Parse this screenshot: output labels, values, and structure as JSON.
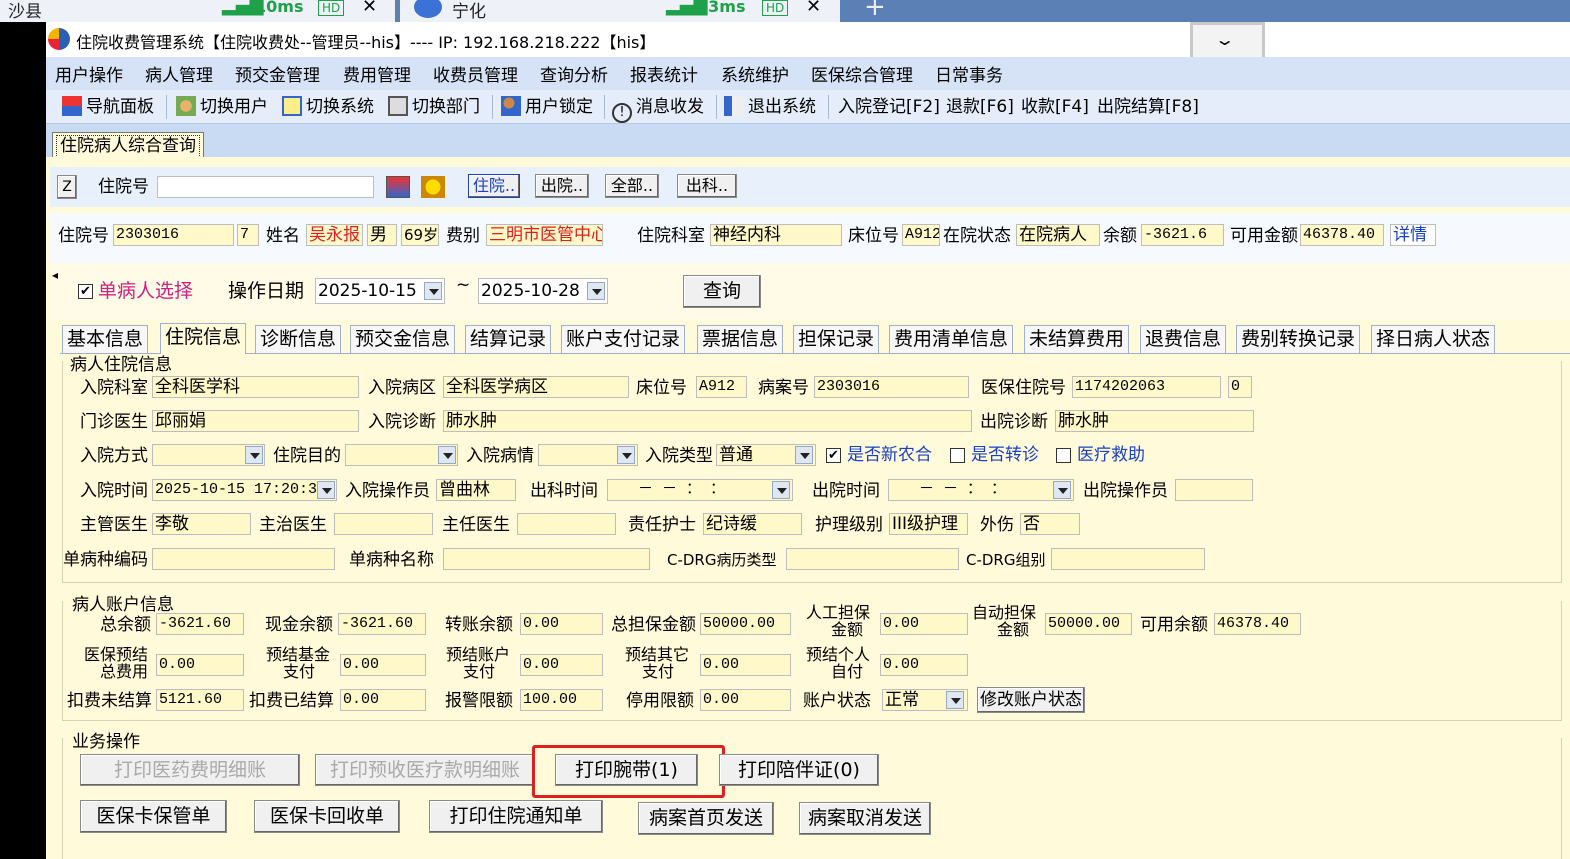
{
  "browser": {
    "tab1": {
      "title": "沙县",
      "latency": "10ms",
      "hd": "HD"
    },
    "tab2": {
      "title": "宁化",
      "latency": "13ms",
      "hd": "HD"
    },
    "close": "✕",
    "new_tab": "+"
  },
  "window": {
    "title": "住院收费管理系统【住院收费处--管理员--his】---- IP: 192.168.218.222【his】"
  },
  "menu": [
    "用户操作",
    "病人管理",
    "预交金管理",
    "费用管理",
    "收费员管理",
    "查询分析",
    "报表统计",
    "系统维护",
    "医保综合管理",
    "日常事务"
  ],
  "toolbar": [
    "导航面板",
    "切换用户",
    "切换系统",
    "切换部门",
    "用户锁定",
    "消息收发",
    "退出系统",
    "入院登记[F2]",
    "退款[F6]",
    "收款[F4]",
    "出院结算[F8]"
  ],
  "mdi_tab": "住院病人综合查询",
  "search": {
    "z": "Z",
    "label": "住院号",
    "value": "",
    "btn_in": "住院..",
    "btn_out": "出院..",
    "btn_all": "全部..",
    "btn_dept": "出科.."
  },
  "patient": {
    "l_no": "住院号",
    "no": "2303016",
    "seq": "7",
    "l_name": "姓名",
    "name": "吴永报",
    "sex": "男",
    "age": "69岁",
    "l_fee": "费别",
    "fee": "三明市医管中心",
    "l_dept": "住院科室",
    "dept": "神经内科",
    "l_bed": "床位号",
    "bed": "A912",
    "l_status": "在院状态",
    "status": "在院病人",
    "l_bal": "余额",
    "bal": "-3621.6",
    "l_avail": "可用金额",
    "avail": "46378.40",
    "detail": "详情"
  },
  "filter": {
    "single": "单病人选择",
    "l_date": "操作日期",
    "from": "2025-10-15",
    "tilde": "~",
    "to": "2025-10-28",
    "query": "查询"
  },
  "tabs": [
    "基本信息",
    "住院信息",
    "诊断信息",
    "预交金信息",
    "结算记录",
    "账户支付记录",
    "票据信息",
    "担保记录",
    "费用清单信息",
    "未结算费用",
    "退费信息",
    "费别转换记录",
    "择日病人状态"
  ],
  "inpatient": {
    "group": "病人住院信息",
    "l_adm_dept": "入院科室",
    "adm_dept": "全科医学科",
    "l_ward": "入院病区",
    "ward": "全科医学病区",
    "l_bed": "床位号",
    "bed": "A912",
    "l_case": "病案号",
    "case": "2303016",
    "l_ins_no": "医保住院号",
    "ins_no": "1174202063",
    "ins_extra": "0",
    "l_clinic_dr": "门诊医生",
    "clinic_dr": "邱丽娟",
    "l_adm_dx": "入院诊断",
    "adm_dx": "肺水肿",
    "l_dis_dx": "出院诊断",
    "dis_dx": "肺水肿",
    "l_adm_way": "入院方式",
    "adm_way": "",
    "l_purpose": "住院目的",
    "purpose": "",
    "l_cond": "入院病情",
    "cond": "",
    "l_type": "入院类型",
    "type": "普通",
    "l_ncms": "是否新农合",
    "l_transfer": "是否转诊",
    "l_aid": "医疗救助",
    "l_adm_time": "入院时间",
    "adm_time": "2025-10-15 17:20:32",
    "l_operator": "入院操作员",
    "operator": "曾曲林",
    "l_out_dept_time": "出科时间",
    "out_dept_time": "－ －   ： ：",
    "l_dis_time": "出院时间",
    "dis_time": "－ －   ： ：",
    "l_dis_op": "出院操作员",
    "dis_op": "",
    "l_chief": "主管医生",
    "chief": "李敬",
    "l_attend": "主治医生",
    "attend": "",
    "l_director": "主任医生",
    "director": "",
    "l_nurse": "责任护士",
    "nurse": "纪诗缓",
    "l_care": "护理级别",
    "care": "III级护理",
    "l_injury": "外伤",
    "injury": "否",
    "l_sd_code": "单病种编码",
    "sd_code": "",
    "l_sd_name": "单病种名称",
    "sd_name": "",
    "l_drg_type": "C-DRG病历类型",
    "drg_type": "",
    "l_drg_group": "C-DRG组别",
    "drg_group": ""
  },
  "account": {
    "group": "病人账户信息",
    "l_total": "总余额",
    "total": "-3621.60",
    "l_cash": "现金余额",
    "cash": "-3621.60",
    "l_transfer": "转账余额",
    "transfer": "0.00",
    "l_guar": "总担保金额",
    "guar": "50000.00",
    "l_manual1": "人工担保",
    "l_manual2": "金额",
    "manual": "0.00",
    "l_auto1": "自动担保",
    "l_auto2": "金额",
    "auto": "50000.00",
    "l_usable": "可用余额",
    "usable": "46378.40",
    "l_pre_total1": "医保预结",
    "l_pre_total2": "总费用",
    "pre_total": "0.00",
    "l_pre_fund1": "预结基金",
    "l_pre_fund2": "支付",
    "pre_fund": "0.00",
    "l_pre_acct1": "预结账户",
    "l_pre_acct2": "支付",
    "pre_acct": "0.00",
    "l_pre_other1": "预结其它",
    "l_pre_other2": "支付",
    "pre_other": "0.00",
    "l_pre_self1": "预结个人",
    "l_pre_self2": "自付",
    "pre_self": "0.00",
    "l_unsettled": "扣费未结算",
    "unsettled": "5121.60",
    "l_settled": "扣费已结算",
    "settled": "0.00",
    "l_alarm": "报警限额",
    "alarm": "100.00",
    "l_stop": "停用限额",
    "stop": "0.00",
    "l_state": "账户状态",
    "state": "正常",
    "modify": "修改账户状态"
  },
  "ops": {
    "group": "业务操作",
    "print_fee": "打印医药费明细账",
    "print_pre": "打印预收医疗款明细账",
    "print_band": "打印腕带(1)",
    "print_escort": "打印陪伴证(0)",
    "ins_keep": "医保卡保管单",
    "ins_recycle": "医保卡回收单",
    "print_notice": "打印住院通知单",
    "case_send": "病案首页发送",
    "case_cancel": "病案取消发送"
  },
  "colors": {
    "highlight_border": "#e02020",
    "field_bg": "#fff8c8",
    "content_bg": "#fffad9",
    "menu_bg": "#d6e3f6",
    "red_text": "#e02020",
    "blue_text": "#1a40c8"
  }
}
